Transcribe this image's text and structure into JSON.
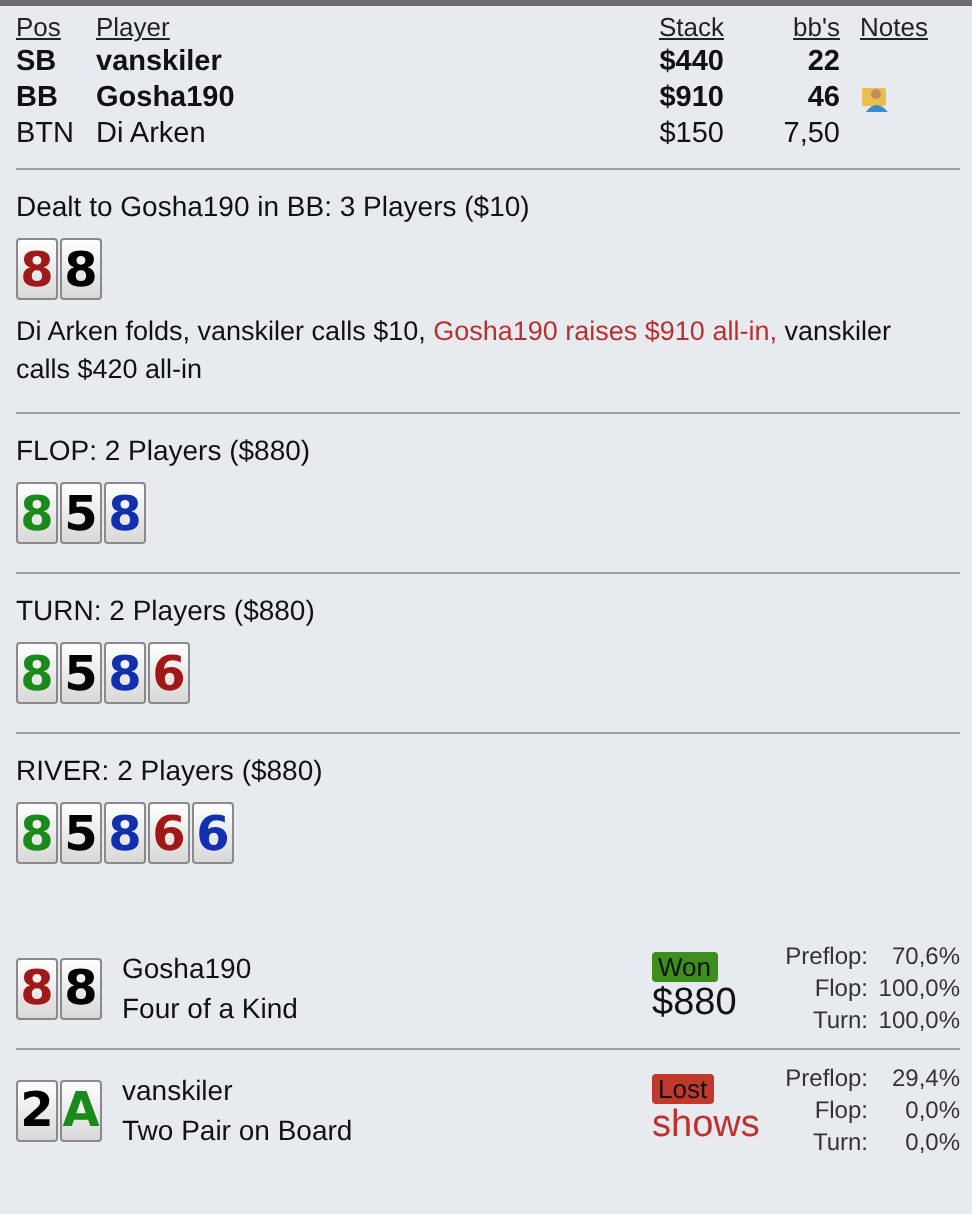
{
  "players": {
    "columns": [
      "Pos",
      "Player",
      "Stack",
      "bb's",
      "Notes"
    ],
    "rows": [
      {
        "pos": "SB",
        "name": "vanskiler",
        "stack": "$440",
        "bbs": "22",
        "bold": true,
        "note": false
      },
      {
        "pos": "BB",
        "name": "Gosha190",
        "stack": "$910",
        "bbs": "46",
        "bold": true,
        "note": true
      },
      {
        "pos": "BTN",
        "name": "Di Arken",
        "stack": "$150",
        "bbs": "7,50",
        "bold": false,
        "note": false
      }
    ]
  },
  "streets": [
    {
      "title": "Dealt to Gosha190 in BB: 3 Players ($10)",
      "cards": [
        {
          "rank": "8",
          "color": "#a01818"
        },
        {
          "rank": "8",
          "color": "#000000"
        }
      ],
      "action": [
        {
          "text": "Di Arken folds, vanskiler calls $10, ",
          "highlight": false
        },
        {
          "text": "Gosha190 raises $910 all-in,",
          "highlight": true
        },
        {
          "text": " vanskiler calls $420 all-in",
          "highlight": false
        }
      ]
    },
    {
      "title": "FLOP: 2 Players ($880)",
      "cards": [
        {
          "rank": "8",
          "color": "#1a8a1a"
        },
        {
          "rank": "5",
          "color": "#000000"
        },
        {
          "rank": "8",
          "color": "#1030b0"
        }
      ]
    },
    {
      "title": "TURN: 2 Players ($880)",
      "cards": [
        {
          "rank": "8",
          "color": "#1a8a1a"
        },
        {
          "rank": "5",
          "color": "#000000"
        },
        {
          "rank": "8",
          "color": "#1030b0"
        },
        {
          "rank": "6",
          "color": "#a01818"
        }
      ]
    },
    {
      "title": "RIVER: 2 Players ($880)",
      "cards": [
        {
          "rank": "8",
          "color": "#1a8a1a"
        },
        {
          "rank": "5",
          "color": "#000000"
        },
        {
          "rank": "8",
          "color": "#1030b0"
        },
        {
          "rank": "6",
          "color": "#a01818"
        },
        {
          "rank": "6",
          "color": "#1030b0"
        }
      ]
    }
  ],
  "results": [
    {
      "cards": [
        {
          "rank": "8",
          "color": "#a01818"
        },
        {
          "rank": "8",
          "color": "#000000"
        }
      ],
      "name": "Gosha190",
      "hand": "Four of a Kind",
      "kind": "won",
      "badge": "Won",
      "amount": "$880",
      "equity": [
        {
          "label": "Preflop:",
          "value": "70,6%"
        },
        {
          "label": "Flop:",
          "value": "100,0%"
        },
        {
          "label": "Turn:",
          "value": "100,0%"
        }
      ]
    },
    {
      "cards": [
        {
          "rank": "2",
          "color": "#000000"
        },
        {
          "rank": "A",
          "color": "#1a8a1a"
        }
      ],
      "name": "vanskiler",
      "hand": "Two Pair on Board",
      "kind": "lost",
      "badge": "Lost",
      "amount": "shows",
      "equity": [
        {
          "label": "Preflop:",
          "value": "29,4%"
        },
        {
          "label": "Flop:",
          "value": "0,0%"
        },
        {
          "label": "Turn:",
          "value": "0,0%"
        }
      ]
    }
  ]
}
